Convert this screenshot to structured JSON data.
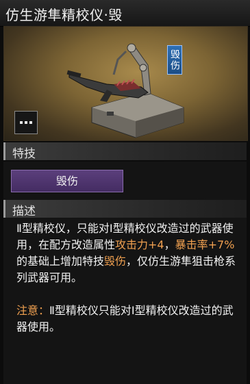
{
  "title": "仿生游隼精校仪·毁",
  "item": {
    "tag": "毁伤",
    "more_icon": "ellipsis-icon"
  },
  "sections": {
    "skill_header": "特技",
    "skill_button": "毁伤",
    "desc_header": "描述"
  },
  "description": {
    "p1_a": "Ⅱ型精校仪，只能对Ⅰ型精校仪改造过的武器使用，在配方改造属性",
    "p1_attack": "攻击力+4",
    "p1_sep": "，",
    "p1_crit": "暴击率+7%",
    "p1_b": "的基础上增加特技",
    "p1_skill": "毁伤",
    "p1_c": "，仅仿生游隼狙击枪系列武器可用。",
    "note_label": "注意：",
    "note_text": "Ⅱ型精校仪只能对Ⅰ型精校仪改造过的武器使用。"
  },
  "colors": {
    "highlight": "#f0a050",
    "skill_button": "#4e3570",
    "tag_badge": "#2a64a8"
  }
}
